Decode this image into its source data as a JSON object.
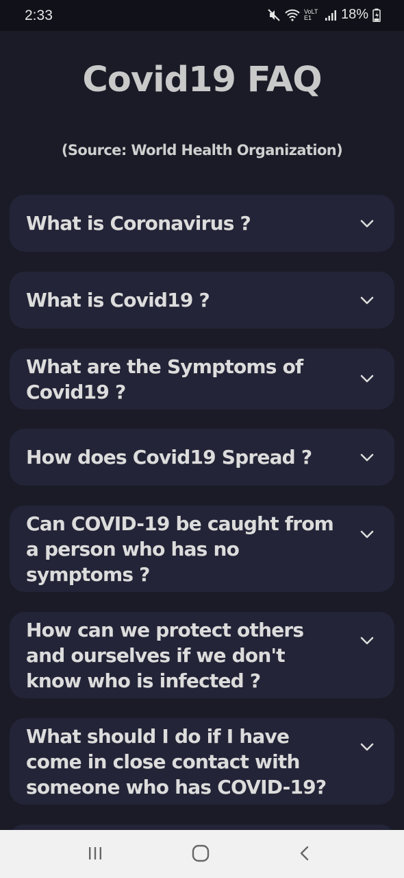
{
  "status_bar": {
    "time": "2:33",
    "network_label": "VoLTE1",
    "battery_percent": "18%"
  },
  "header": {
    "title": "Covid19 FAQ",
    "subtitle": "(Source: World Health Organization)"
  },
  "faq_items": [
    {
      "question": "What is Coronavirus ?"
    },
    {
      "question": "What is Covid19 ?"
    },
    {
      "question": "What are the Symptoms of Covid19 ?"
    },
    {
      "question": "How does Covid19 Spread ?"
    },
    {
      "question": "Can COVID-19 be caught from a person who has no symptoms ?"
    },
    {
      "question": "How can we protect others and ourselves if we don't know who is infected ?"
    },
    {
      "question": "What should I do if I have come in close contact with someone who has COVID-19?"
    }
  ],
  "icons": {
    "expand": "chevron-down-icon",
    "nav_recents": "recents-icon",
    "nav_home": "home-icon",
    "nav_back": "back-icon"
  },
  "colors": {
    "background": "#1a1b27",
    "card": "#232437",
    "text": "#dcdcdc",
    "nav_bar": "#f1f1f1"
  }
}
